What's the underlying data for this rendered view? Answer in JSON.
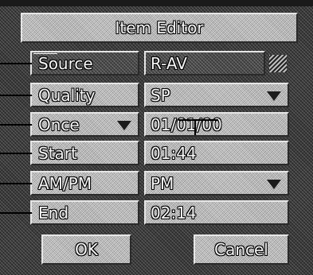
{
  "title": "Item Editor",
  "fields": [
    {
      "label": "Source",
      "value": "R-AV"
    },
    {
      "label": "Quality",
      "value": "SP"
    },
    {
      "label": "Once",
      "value": "01/01/00"
    },
    {
      "label": "Start",
      "value": "01:44"
    },
    {
      "label": "AM/PM",
      "value": "PM"
    },
    {
      "label": "End",
      "value": "02:14"
    }
  ],
  "buttons": {
    "ok": "OK",
    "cancel": "Cancel"
  },
  "icons": {
    "dropdown": "triangle-down-icon",
    "grip": "striped-grip-icon"
  },
  "colors": {
    "panel": "#a8a8a8",
    "panel_active": "#4a4a4a",
    "background": "#3a3a3a",
    "text": "#f6f6f6"
  }
}
